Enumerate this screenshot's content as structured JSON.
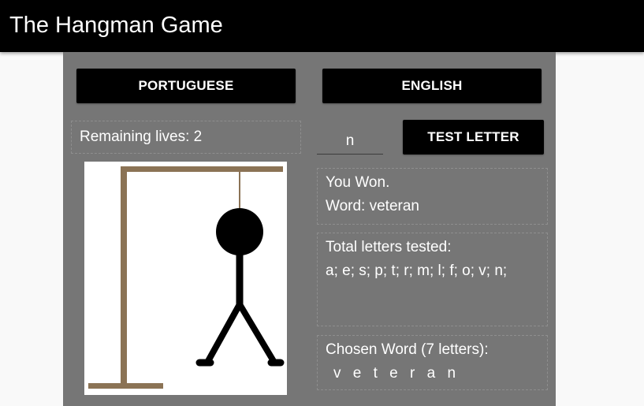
{
  "app": {
    "title": "The Hangman Game"
  },
  "languages": {
    "portuguese_label": "PORTUGUESE",
    "english_label": "ENGLISH"
  },
  "status": {
    "lives_label": "Remaining lives: 2"
  },
  "guess": {
    "input_value": "n",
    "test_button_label": "TEST LETTER"
  },
  "result": {
    "message": "You Won.",
    "word_line": "Word: veteran"
  },
  "tested": {
    "heading": "Total letters tested:",
    "letters": "a; e; s; p; t; r; m; l; f; o; v; n;"
  },
  "chosen": {
    "heading": "Chosen Word (7 letters):",
    "letters": "v e t e r a n"
  },
  "colors": {
    "header_bg": "#000000",
    "panel_bg": "#767676",
    "gallows": "#8b7355",
    "figure": "#000000"
  }
}
